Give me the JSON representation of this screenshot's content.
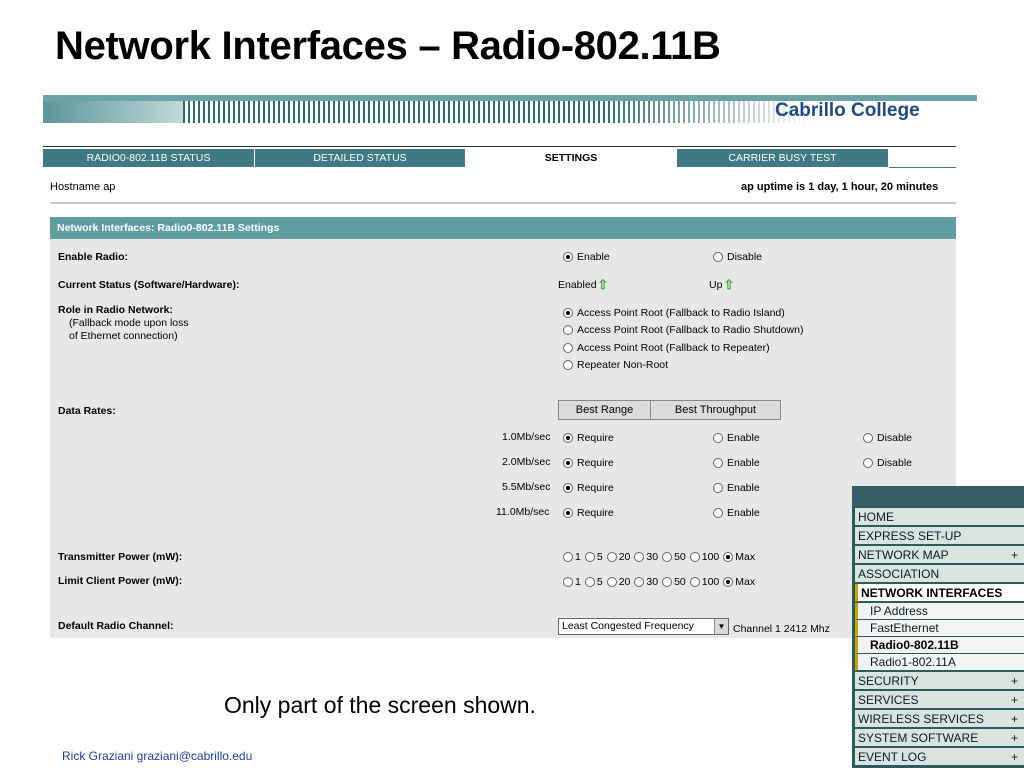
{
  "slide": {
    "title": "Network Interfaces – Radio-802.11B",
    "note": "Only part of the screen shown.",
    "footer": "Rick Graziani  graziani@cabrillo.edu"
  },
  "banner": {
    "brand": "Cabrillo College"
  },
  "tabs": [
    {
      "label": "RADIO0-802.11B  STATUS",
      "active": false
    },
    {
      "label": "DETAILED STATUS",
      "active": false
    },
    {
      "label": "SETTINGS",
      "active": true
    },
    {
      "label": "CARRIER BUSY TEST",
      "active": false
    }
  ],
  "status_line": {
    "hostname": "Hostname  ap",
    "uptime": "ap uptime is 1 day, 1 hour, 20 minutes"
  },
  "panel": {
    "header": "Network Interfaces: Radio0-802.11B Settings",
    "enable_radio": {
      "label": "Enable Radio:",
      "options": [
        "Enable",
        "Disable"
      ],
      "selected": "Enable"
    },
    "current_status": {
      "label": "Current Status (Software/Hardware):",
      "software": "Enabled",
      "hardware": "Up"
    },
    "role": {
      "label": "Role in Radio Network:",
      "note_line1": "(Fallback mode upon loss",
      "note_line2": "of Ethernet connection)",
      "options": [
        "Access Point Root (Fallback to Radio Island)",
        "Access Point Root (Fallback to Radio Shutdown)",
        "Access Point Root (Fallback to Repeater)",
        "Repeater Non-Root"
      ],
      "selected": "Access Point Root (Fallback to Radio Island)"
    },
    "data_rates": {
      "label": "Data Rates:",
      "best_range_button": "Best Range",
      "best_throughput_button": "Best Throughput",
      "choices": [
        "Require",
        "Enable",
        "Disable"
      ],
      "rows": [
        {
          "rate": "1.0Mb/sec",
          "selected": "Require"
        },
        {
          "rate": "2.0Mb/sec",
          "selected": "Require"
        },
        {
          "rate": "5.5Mb/sec",
          "selected": "Require"
        },
        {
          "rate": "11.0Mb/sec",
          "selected": "Require"
        }
      ]
    },
    "tx_power": {
      "label": "Transmitter Power (mW):",
      "options": [
        "1",
        "5",
        "20",
        "30",
        "50",
        "100",
        "Max"
      ],
      "selected": "Max"
    },
    "client_power": {
      "label": "Limit Client Power (mW):",
      "options": [
        "1",
        "5",
        "20",
        "30",
        "50",
        "100",
        "Max"
      ],
      "selected": "Max"
    },
    "channel": {
      "label": "Default Radio Channel:",
      "value": "Least Congested Frequency",
      "info": "Channel 1  2412 Mhz"
    }
  },
  "menu": {
    "items": [
      {
        "label": "HOME",
        "plus": ""
      },
      {
        "label": "EXPRESS SET-UP",
        "plus": ""
      },
      {
        "label": "NETWORK MAP",
        "plus": "+"
      },
      {
        "label": "ASSOCIATION",
        "plus": ""
      },
      {
        "label": "NETWORK INTERFACES",
        "plus": ""
      },
      {
        "label": "IP Address",
        "plus": ""
      },
      {
        "label": "FastEthernet",
        "plus": ""
      },
      {
        "label": "Radio0-802.11B",
        "plus": ""
      },
      {
        "label": "Radio1-802.11A",
        "plus": ""
      },
      {
        "label": "SECURITY",
        "plus": "+"
      },
      {
        "label": "SERVICES",
        "plus": "+"
      },
      {
        "label": "WIRELESS SERVICES",
        "plus": "+"
      },
      {
        "label": "SYSTEM SOFTWARE",
        "plus": "+"
      },
      {
        "label": "EVENT LOG",
        "plus": "+"
      }
    ]
  }
}
